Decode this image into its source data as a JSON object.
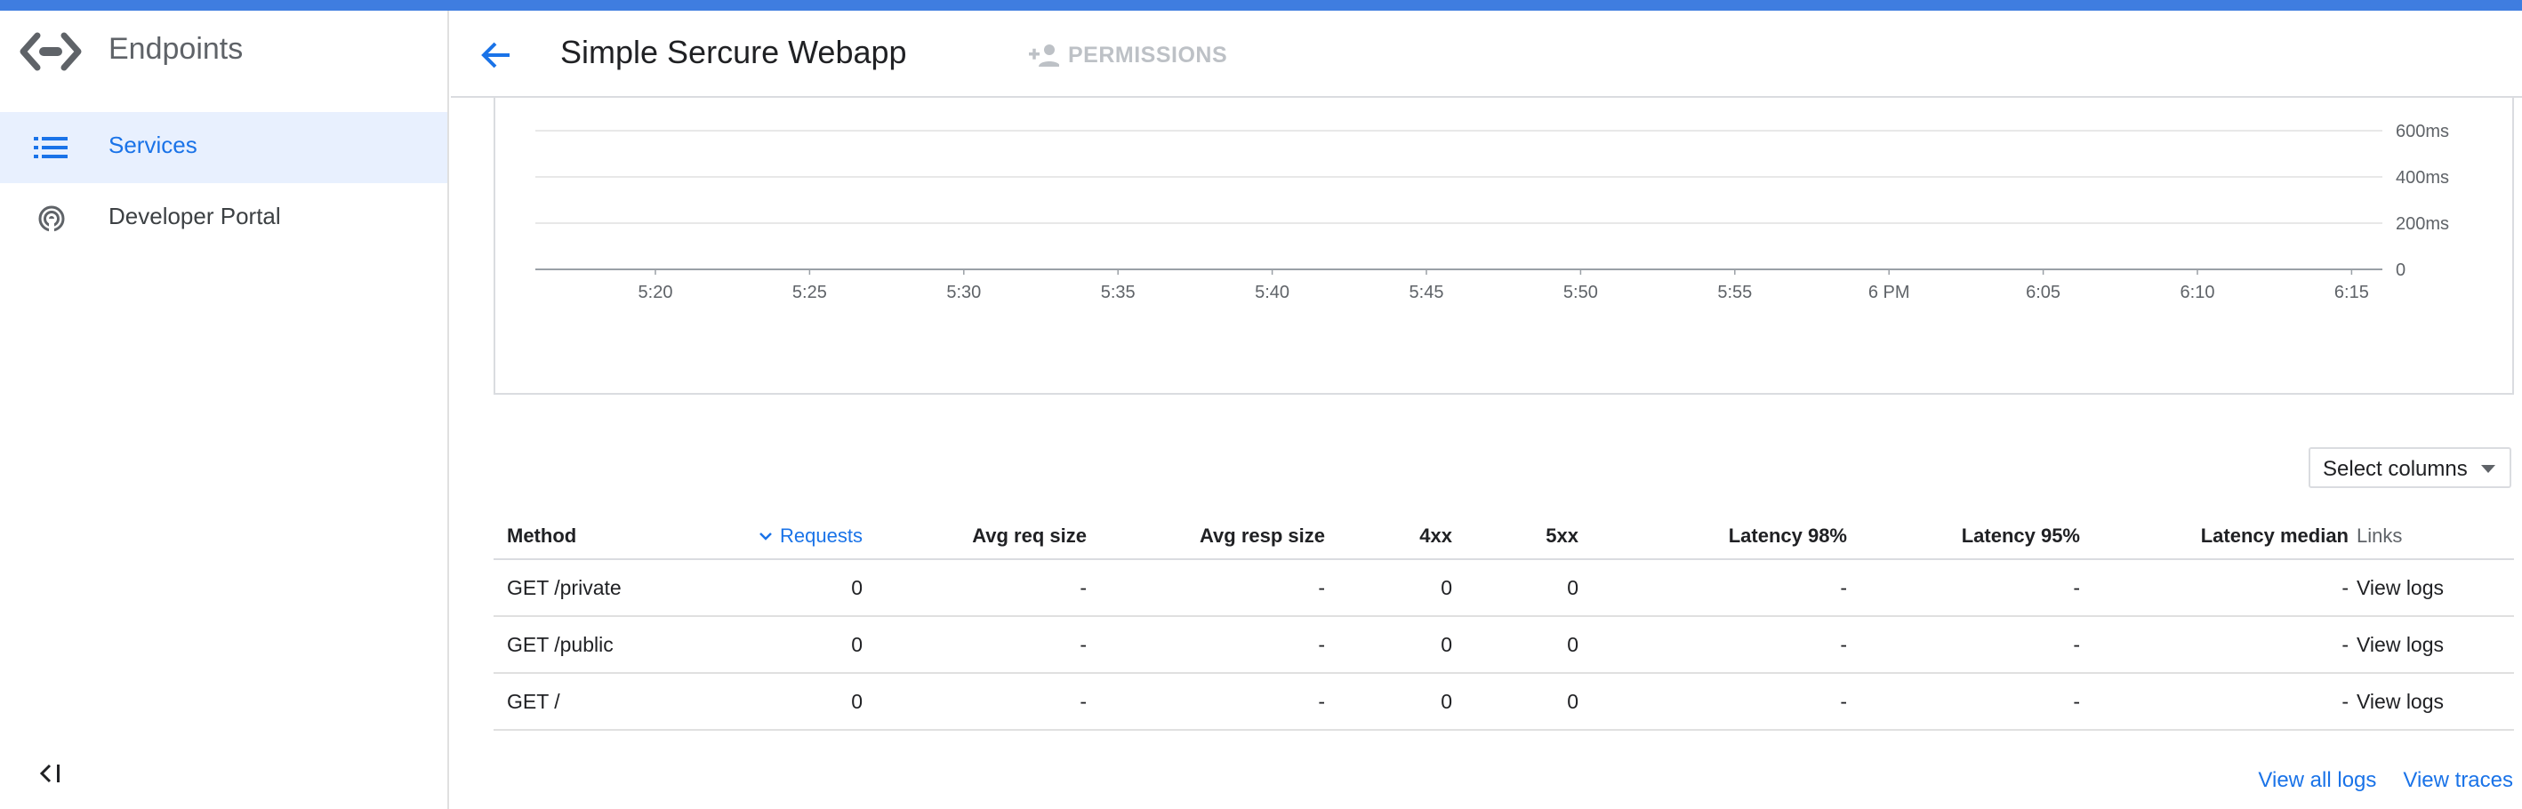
{
  "app": {
    "title": "Endpoints",
    "accent": "#3f7de0",
    "brand_icon": "endpoints-logo-icon"
  },
  "sidebar": {
    "items": [
      {
        "label": "Services",
        "icon": "list-icon",
        "active": true
      },
      {
        "label": "Developer Portal",
        "icon": "portal-icon",
        "active": false
      }
    ],
    "collapse_icon": "collapse-sidebar-icon"
  },
  "header": {
    "title": "Simple Sercure Webapp",
    "back_icon": "arrow-back-icon",
    "permissions_label": "PERMISSIONS",
    "permissions_icon": "person-add-icon"
  },
  "chart_data": {
    "type": "line",
    "title": "",
    "xlabel": "",
    "ylabel": "",
    "x_ticks": [
      "5:20",
      "5:25",
      "5:30",
      "5:35",
      "5:40",
      "5:45",
      "5:50",
      "5:55",
      "6 PM",
      "6:05",
      "6:10",
      "6:15"
    ],
    "y_ticks": [
      "600ms",
      "400ms",
      "200ms",
      "0"
    ],
    "ylim": [
      0,
      600
    ],
    "series": [],
    "grid": true,
    "y_axis_side": "right"
  },
  "select_columns": {
    "label": "Select columns"
  },
  "table": {
    "columns": [
      "Method",
      "Requests",
      "Avg req size",
      "Avg resp size",
      "4xx",
      "5xx",
      "Latency 98%",
      "Latency 95%",
      "Latency median",
      "Links"
    ],
    "sorted_column": "Requests",
    "rows": [
      {
        "method": "GET /private",
        "requests": "0",
        "avg_req": "-",
        "avg_resp": "-",
        "c4xx": "0",
        "c5xx": "0",
        "lat98": "-",
        "lat95": "-",
        "latmed": "-",
        "link": "View logs"
      },
      {
        "method": "GET /public",
        "requests": "0",
        "avg_req": "-",
        "avg_resp": "-",
        "c4xx": "0",
        "c5xx": "0",
        "lat98": "-",
        "lat95": "-",
        "latmed": "-",
        "link": "View logs"
      },
      {
        "method": "GET /",
        "requests": "0",
        "avg_req": "-",
        "avg_resp": "-",
        "c4xx": "0",
        "c5xx": "0",
        "lat98": "-",
        "lat95": "-",
        "latmed": "-",
        "link": "View logs"
      }
    ]
  },
  "footer": {
    "view_all_logs": "View all logs",
    "view_traces": "View traces"
  }
}
